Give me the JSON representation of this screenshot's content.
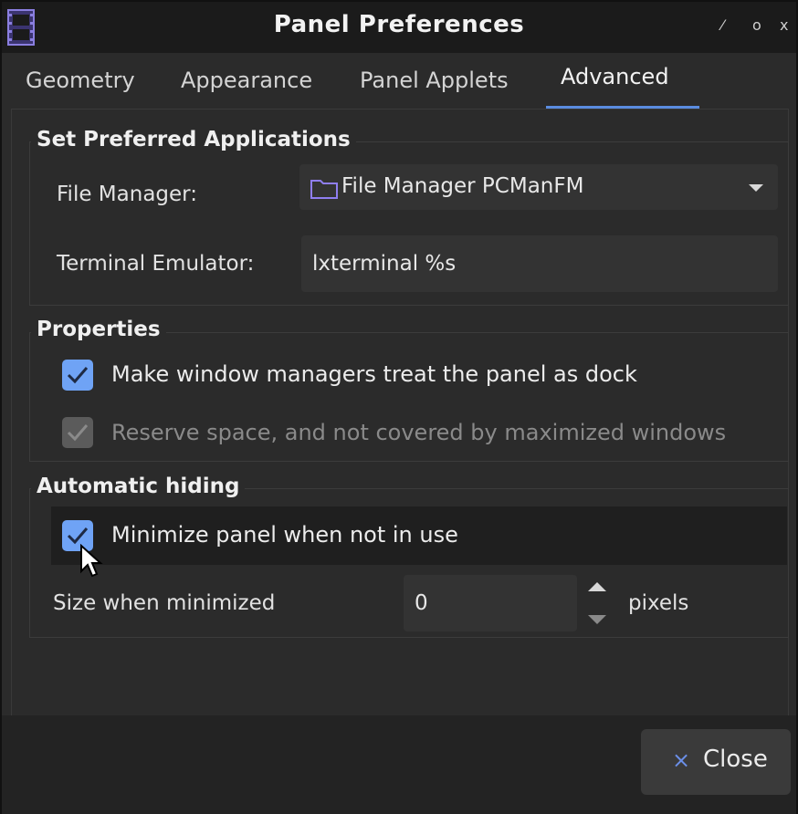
{
  "window": {
    "title": "Panel Preferences",
    "controls": {
      "minimize": "⁄",
      "maximize": "o",
      "close": "x"
    }
  },
  "tabs": [
    {
      "label": "Geometry",
      "active": false
    },
    {
      "label": "Appearance",
      "active": false
    },
    {
      "label": "Panel Applets",
      "active": false
    },
    {
      "label": "Advanced",
      "active": true
    }
  ],
  "preferred_apps": {
    "title": "Set Preferred Applications",
    "file_manager_label": "File Manager:",
    "file_manager_value": "File Manager PCManFM",
    "terminal_label": "Terminal Emulator:",
    "terminal_value": "lxterminal %s"
  },
  "properties": {
    "title": "Properties",
    "dock_label": "Make window managers treat the panel as dock",
    "dock_checked": true,
    "reserve_label": "Reserve space, and not covered by maximized windows",
    "reserve_checked": true,
    "reserve_disabled": true
  },
  "auto_hide": {
    "title": "Automatic hiding",
    "minimize_label": "Minimize panel when not in use",
    "minimize_checked": true,
    "size_label": "Size when minimized",
    "size_value": "0",
    "size_unit": "pixels"
  },
  "footer": {
    "close_icon": "×",
    "close_label": "Close"
  },
  "colors": {
    "accent": "#6fa3f5",
    "tab_underline": "#5a8ce0",
    "background": "#2b2b2b"
  }
}
